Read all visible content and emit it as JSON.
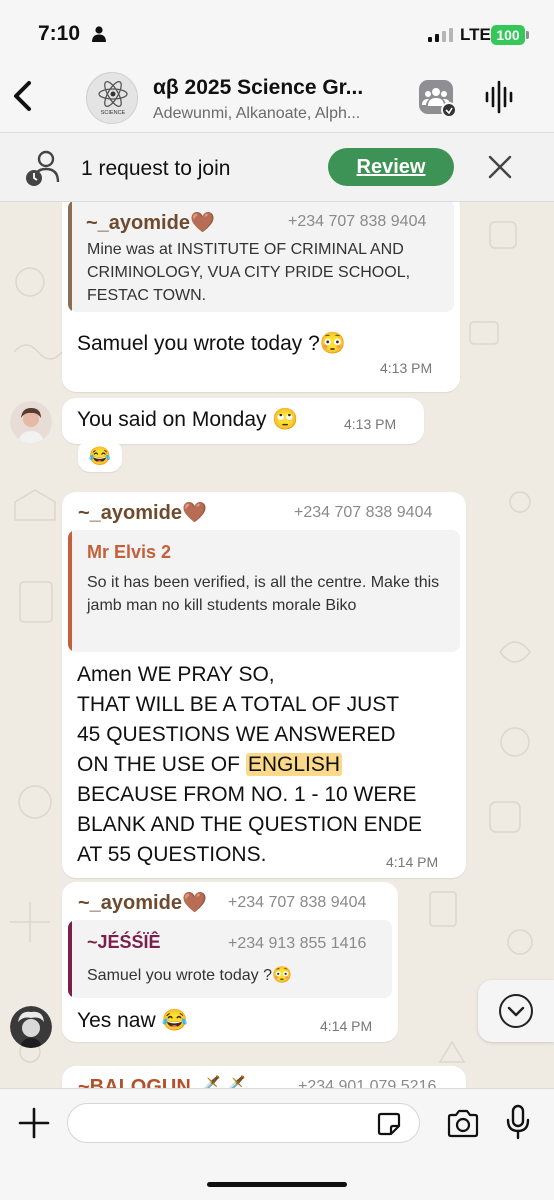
{
  "status_bar": {
    "time": "7:10",
    "network": "LTE",
    "battery": "100"
  },
  "header": {
    "title": "αβ 2025 Science Gr...",
    "members": "Adewunmi, Alkanoate, Alph...",
    "avatar_text": "SCIENCE"
  },
  "join_bar": {
    "text": "1 request to join",
    "review_label": "Review"
  },
  "messages": [
    {
      "sender": "~_ayomide🤎",
      "phone": "+234 707 838 9404",
      "quoted_text": "Mine was at INSTITUTE OF CRIMINAL AND CRIMINOLOGY, VUA CITY PRIDE SCHOOL, FESTAC TOWN.",
      "text": "Samuel you wrote today ?😳",
      "time": "4:13 PM"
    },
    {
      "text": "You said on Monday 🙄",
      "time": "4:13 PM",
      "reaction": "😂"
    },
    {
      "sender": "~_ayomide🤎",
      "phone": "+234 707 838 9404",
      "quoted_sender": "Mr Elvis 2",
      "quoted_text": "So it has been verified, is all the centre. Make this jamb man no kill students morale Biko",
      "text_lines": [
        "Amen WE PRAY SO,",
        "THAT WILL BE A TOTAL OF JUST",
        "45 QUESTIONS WE ANSWERED",
        "ON THE USE OF",
        "ENGLISH",
        "BECAUSE FROM NO. 1 - 10 WERE",
        "BLANK AND THE QUESTION ENDE",
        "AT 55 QUESTIONS."
      ],
      "time": "4:14 PM"
    },
    {
      "sender": "~_ayomide🤎",
      "phone": "+234 707 838 9404",
      "quoted_sender": "~JÉŚŚÏÊ",
      "quoted_phone": "+234 913 855 1416",
      "quoted_text": "Samuel you wrote today ?😳",
      "text": "Yes naw 😂",
      "time": "4:14 PM"
    },
    {
      "sender": "~BALOGUN 🗡️🗡️",
      "phone": "+234 901 079 5216"
    }
  ],
  "input": {
    "placeholder": ""
  },
  "colors": {
    "review_button": "#3d9355",
    "sender_brown": "#6e4b2f",
    "quote_orange": "#c4603a",
    "quote_maroon": "#7a1f4a",
    "chat_background": "#efeae2",
    "highlight": "#fad98a"
  },
  "icons": [
    "person-icon",
    "signal-icon",
    "back-icon",
    "community-icon",
    "voice-wave-icon",
    "join-request-icon",
    "close-icon",
    "chevron-down-icon",
    "plus-icon",
    "sticker-icon",
    "camera-icon",
    "microphone-icon"
  ]
}
